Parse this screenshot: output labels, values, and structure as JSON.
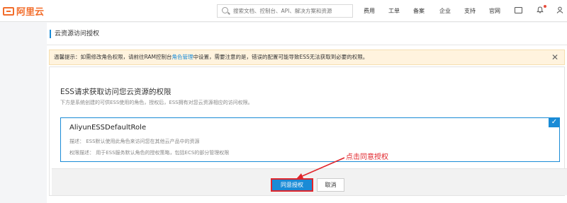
{
  "topbar": {
    "logo_text": "阿里云",
    "search_placeholder": "搜索文档、控制台、API、解决方案和资源",
    "nav": [
      "费用",
      "工单",
      "备案",
      "企业",
      "支持",
      "官网"
    ]
  },
  "page": {
    "title": "云资源访问授权"
  },
  "notice": {
    "prefix": "温馨提示：如需修改角色权限，请前往RAM控制台",
    "link": "角色管理",
    "suffix": "中设置，需要注意的是，错误的配置可能导致ESS无法获取到必要的权限。",
    "close": "✕"
  },
  "panel": {
    "title": "ESS请求获取访问您云资源的权限",
    "subtitle": "下方是系统创建的可供ESS使用的角色，授权后，ESS拥有对您云资源相应的访问权限。",
    "role": {
      "name": "AliyunESSDefaultRole",
      "desc": "描述： ESS默认使用此角色来访问您在其他云产品中的资源",
      "perm": "权限描述： 用于ESS服务默认角色的授权策略，包括ECS的部分管理权限",
      "check": "✓"
    }
  },
  "buttons": {
    "agree": "同意授权",
    "cancel": "取消"
  },
  "annotation": "点击同意授权",
  "colors": {
    "accent": "#1a8bd6",
    "brand": "#f26d2b",
    "highlight": "#e1252b",
    "notice_bg": "#fff3de"
  }
}
